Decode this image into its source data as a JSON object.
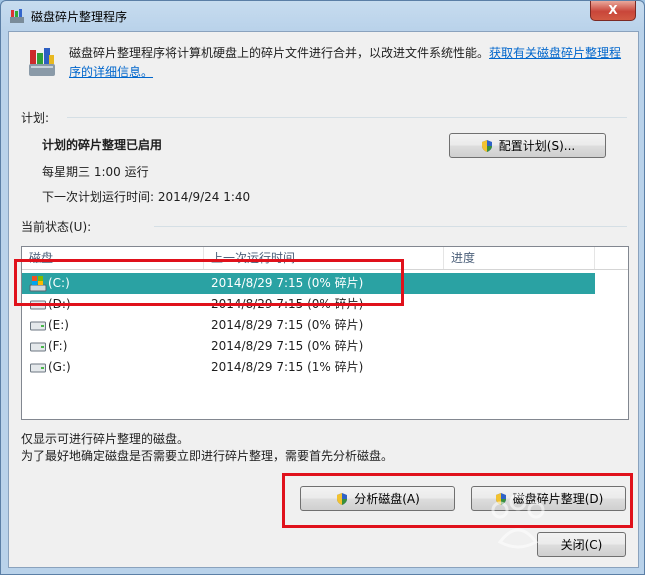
{
  "window": {
    "title": "磁盘碎片整理程序",
    "close_glyph": "X"
  },
  "description": {
    "text": "磁盘碎片整理程序将计算机硬盘上的碎片文件进行合并，以改进文件系统性能。",
    "link": "获取有关磁盘碎片整理程序的详细信息。"
  },
  "schedule": {
    "label": "计划:",
    "status": "计划的碎片整理已启用",
    "frequency": "每星期三  1:00 运行",
    "next_run": "下一次计划运行时间: 2014/9/24 1:40",
    "configure_button": "配置计划(S)..."
  },
  "current_status": {
    "label": "当前状态(U):",
    "columns": [
      "磁盘",
      "上一次运行时间",
      "进度"
    ],
    "rows": [
      {
        "disk": "(C:)",
        "last_run": "2014/8/29 7:15 (0% 碎片)",
        "progress": "",
        "selected": true
      },
      {
        "disk": "(D:)",
        "last_run": "2014/8/29 7:15 (0% 碎片)",
        "progress": "",
        "selected": false
      },
      {
        "disk": "(E:)",
        "last_run": "2014/8/29 7:15 (0% 碎片)",
        "progress": "",
        "selected": false
      },
      {
        "disk": "(F:)",
        "last_run": "2014/8/29 7:15 (0% 碎片)",
        "progress": "",
        "selected": false
      },
      {
        "disk": "(G:)",
        "last_run": "2014/8/29 7:15 (1% 碎片)",
        "progress": "",
        "selected": false
      }
    ]
  },
  "notes": {
    "line1": "仅显示可进行碎片整理的磁盘。",
    "line2": "为了最好地确定磁盘是否需要立即进行碎片整理，需要首先分析磁盘。"
  },
  "buttons": {
    "analyze": "分析磁盘(A)",
    "defrag": "磁盘碎片整理(D)",
    "close": "关闭(C)"
  },
  "colors": {
    "selected_row": "#2aa2a3",
    "annotation": "#e0111b",
    "link": "#0066cc"
  }
}
